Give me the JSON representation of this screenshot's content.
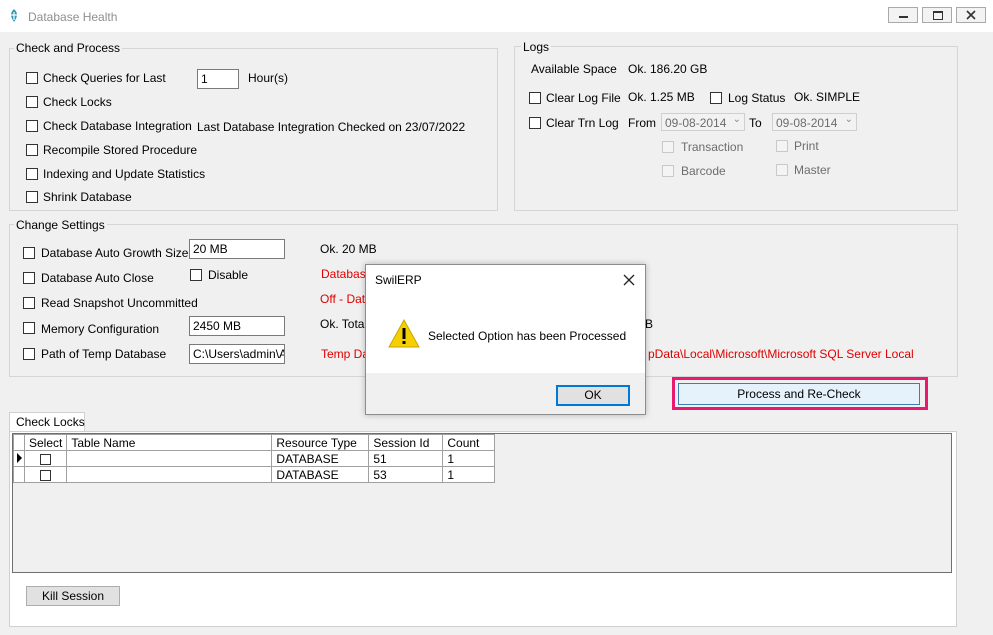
{
  "window": {
    "title": "Database Health",
    "minimize_icon": "minimize-icon",
    "maximize_icon": "restore-icon",
    "close_icon": "close-icon"
  },
  "check_process": {
    "label": "Check and Process",
    "check_queries": "Check Queries for Last",
    "hours_value": "1",
    "hours_unit": "Hour(s)",
    "check_locks": "Check Locks",
    "check_integration": "Check Database Integration",
    "integration_status": "Last Database Integration Checked on 23/07/2022",
    "recompile": "Recompile Stored Procedure",
    "indexing": "Indexing and Update Statistics",
    "shrink": "Shrink Database"
  },
  "logs": {
    "label": "Logs",
    "available_space_label": "Available Space",
    "available_space_value": "Ok. 186.20 GB",
    "clear_log_file": "Clear Log File",
    "log_file_value": "Ok. 1.25 MB",
    "log_status": "Log Status",
    "log_status_value": "Ok. SIMPLE",
    "clear_trn_log": "Clear Trn Log",
    "from_label": "From",
    "from_date": "09-08-2014",
    "to_label": "To",
    "to_date": "09-08-2014",
    "transaction": "Transaction",
    "print": "Print",
    "barcode": "Barcode",
    "master": "Master"
  },
  "change_settings": {
    "label": "Change Settings",
    "auto_growth": "Database Auto Growth Size",
    "auto_growth_value": "20 MB",
    "auto_growth_status": "Ok. 20 MB",
    "auto_close": "Database Auto Close",
    "disable": "Disable",
    "auto_close_status": "Database",
    "snapshot": "Read Snapshot Uncommitted",
    "snapshot_status": "Off - Data",
    "memory": "Memory Configuration",
    "memory_value": "2450 MB",
    "memory_status": "Ok. Total",
    "memory_status_tail": "B",
    "temp_db": "Path of Temp Database",
    "temp_db_value": "C:\\Users\\admin\\AppData",
    "temp_db_status": "Temp Dat",
    "temp_db_status_tail": "pData\\Local\\Microsoft\\Microsoft SQL Server Local"
  },
  "process_button": "Process and Re-Check",
  "tab": {
    "label": "Check Locks"
  },
  "grid": {
    "columns": [
      "Select",
      "Table Name",
      "Resource Type",
      "Session Id",
      "Count"
    ],
    "rows": [
      {
        "table_name": "",
        "resource_type": "DATABASE",
        "session_id": "51",
        "count": "1"
      },
      {
        "table_name": "",
        "resource_type": "DATABASE",
        "session_id": "53",
        "count": "1"
      }
    ]
  },
  "kill_session": "Kill Session",
  "dialog": {
    "title": "SwilERP",
    "message": "Selected Option has been Processed",
    "ok": "OK",
    "icon": "warning-icon"
  },
  "colors": {
    "highlight": "#e8196e",
    "status_red": "#e00000"
  }
}
